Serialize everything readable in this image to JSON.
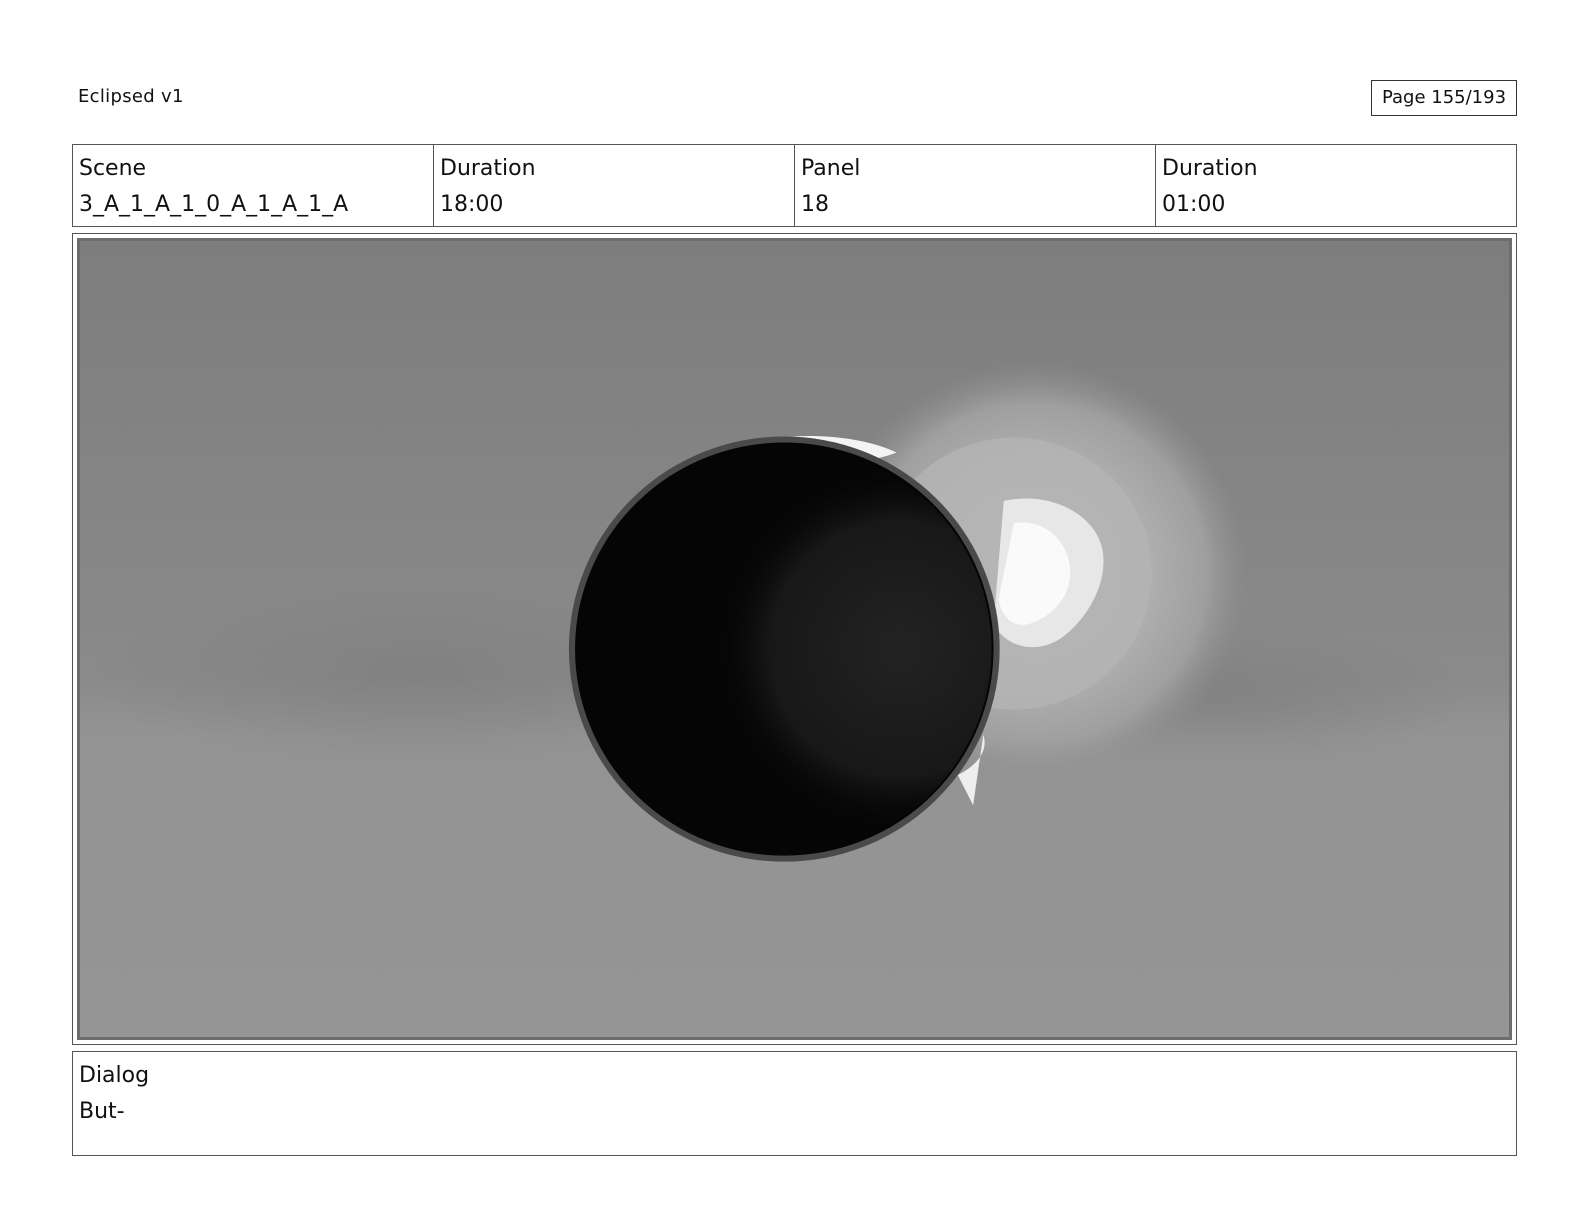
{
  "header": {
    "doc_title": "Eclipsed v1",
    "page_indicator": "Page 155/193"
  },
  "info": {
    "scene_label": "Scene",
    "scene_value": "3_A_1_A_1_0_A_1_A_1_A",
    "scene_duration_label": "Duration",
    "scene_duration_value": "18:00",
    "panel_label": "Panel",
    "panel_value": "18",
    "panel_duration_label": "Duration",
    "panel_duration_value": "01:00"
  },
  "panel_image": {
    "description_icon": "eclipse-sketch",
    "colors": {
      "sky_top": "#7e7e7e",
      "sky_bottom": "#959595",
      "moon": "#050505",
      "glow": "#c8c8c8",
      "corona": "#f2f2f2"
    }
  },
  "dialog": {
    "label": "Dialog",
    "text": "But-"
  }
}
